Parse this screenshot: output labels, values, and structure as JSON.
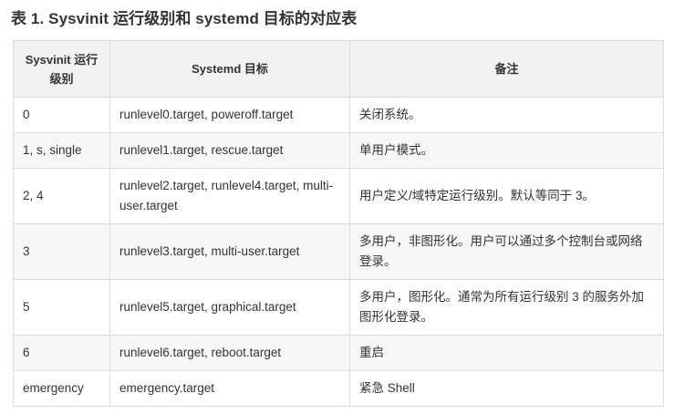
{
  "title": "表 1. Sysvinit 运行级别和 systemd 目标的对应表",
  "table": {
    "headers": [
      "Sysvinit 运行级别",
      "Systemd 目标",
      "备注"
    ],
    "rows": [
      [
        "0",
        "runlevel0.target, poweroff.target",
        "关闭系统。"
      ],
      [
        "1, s, single",
        "runlevel1.target, rescue.target",
        "单用户模式。"
      ],
      [
        "2, 4",
        "runlevel2.target, runlevel4.target, multi-user.target",
        "用户定义/域特定运行级别。默认等同于 3。"
      ],
      [
        "3",
        "runlevel3.target, multi-user.target",
        "多用户，非图形化。用户可以通过多个控制台或网络登录。"
      ],
      [
        "5",
        "runlevel5.target, graphical.target",
        "多用户，图形化。通常为所有运行级别 3 的服务外加图形化登录。"
      ],
      [
        "6",
        "runlevel6.target, reboot.target",
        "重启"
      ],
      [
        "emergency",
        "emergency.target",
        "紧急 Shell"
      ]
    ]
  }
}
